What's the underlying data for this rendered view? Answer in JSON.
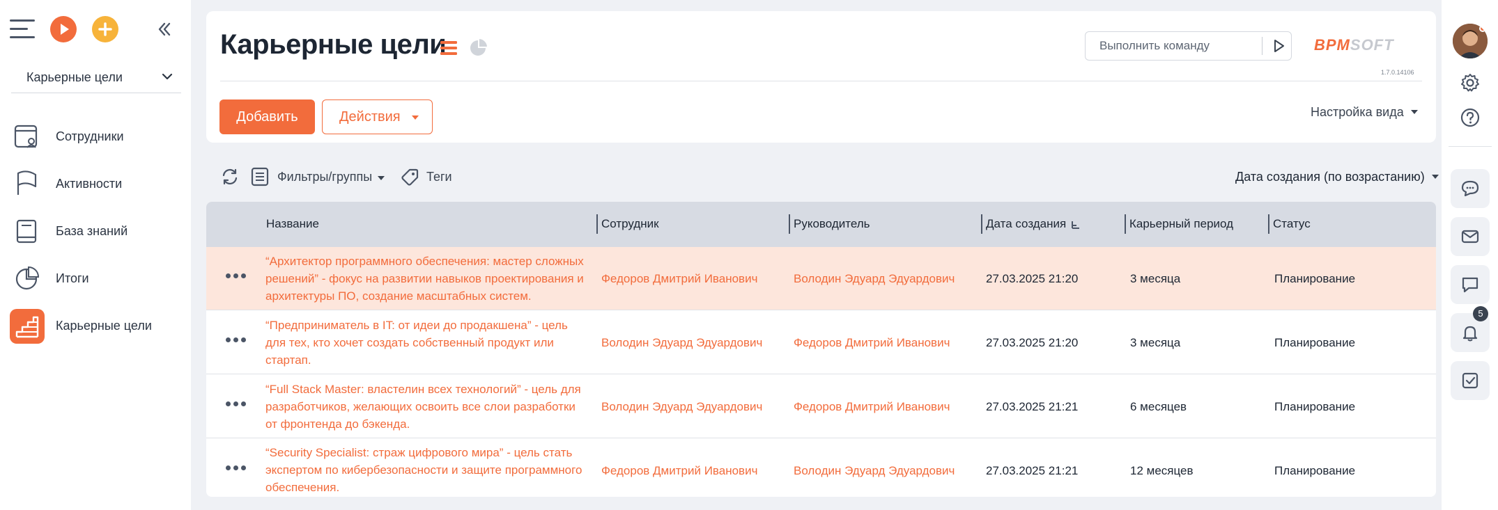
{
  "sidebar": {
    "section_select": "Карьерные цели",
    "items": [
      {
        "label": "Сотрудники",
        "icon": "employee-card-icon"
      },
      {
        "label": "Активности",
        "icon": "flag-icon"
      },
      {
        "label": "База знаний",
        "icon": "book-icon"
      },
      {
        "label": "Итоги",
        "icon": "pie-chart-icon"
      },
      {
        "label": "Карьерные цели",
        "icon": "career-stairs-icon",
        "active": true
      }
    ]
  },
  "header": {
    "title": "Карьерные цели",
    "command_placeholder": "Выполнить команду",
    "brand_part1": "BPM",
    "brand_part2": "SOFT",
    "version": "1.7.0.14106",
    "add_label": "Добавить",
    "actions_label": "Действия",
    "view_settings_label": "Настройка вида"
  },
  "toolbar": {
    "filters_label": "Фильтры/группы",
    "tags_label": "Теги",
    "sort_label": "Дата создания (по возрастанию)"
  },
  "grid": {
    "columns": [
      "Название",
      "Сотрудник",
      "Руководитель",
      "Дата создания",
      "Карьерный период",
      "Статус"
    ],
    "rows": [
      {
        "name": "“Архитектор программного обеспечения: мастер сложных решений” - фокус на развитии навыков проектирования и архитектуры ПО, создание масштабных систем.",
        "employee": "Федоров Дмитрий Иванович",
        "manager": "Володин Эдуард Эдуардович",
        "created": "27.03.2025 21:20",
        "period": "3 месяца",
        "status": "Планирование"
      },
      {
        "name": "“Предприниматель в IT: от идеи до продакшена” - цель для тех, кто хочет создать собственный продукт или стартап.",
        "employee": "Володин Эдуард Эдуардович",
        "manager": "Федоров Дмитрий Иванович",
        "created": "27.03.2025 21:20",
        "period": "3 месяца",
        "status": "Планирование"
      },
      {
        "name": "“Full Stack Master: властелин всех технологий” - цель для разработчиков, желающих освоить все слои разработки от фронтенда до бэкенда.",
        "employee": "Володин Эдуард Эдуардович",
        "manager": "Федоров Дмитрий Иванович",
        "created": "27.03.2025 21:21",
        "period": "6 месяцев",
        "status": "Планирование"
      },
      {
        "name": "“Security Specialist: страж цифрового мира” - цель стать экспертом по кибербезопасности и защите программного обеспечения.",
        "employee": "Федоров Дмитрий Иванович",
        "manager": "Володин Эдуард Эдуардович",
        "created": "27.03.2025 21:21",
        "period": "12 месяцев",
        "status": "Планирование"
      }
    ]
  },
  "rail": {
    "notification_count": "5"
  },
  "colors": {
    "accent": "#f26c3c",
    "accent_yellow": "#f7b33a",
    "selected_row": "#fde6dc",
    "grid_header": "#d7dbe3",
    "background": "#eff1f5"
  }
}
